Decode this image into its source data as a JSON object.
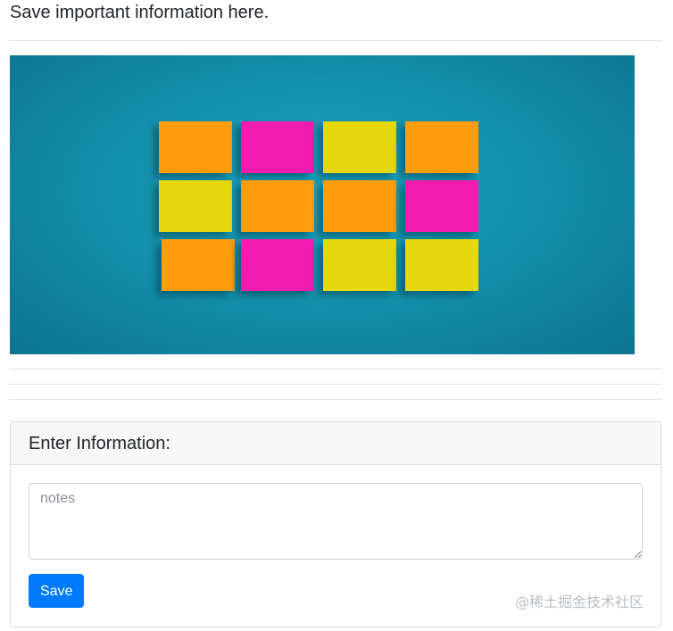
{
  "header": {
    "headline": "Save important information here."
  },
  "hero": {
    "description_icon": "sticky-notes-photo",
    "colors": {
      "background": "#1391ad",
      "orange": "#ff9d0a",
      "magenta": "#f01ab0",
      "yellow": "#e6d80a"
    },
    "notes_grid": [
      [
        "orange",
        "magenta",
        "yellow",
        "orange"
      ],
      [
        "yellow",
        "orange",
        "orange",
        "magenta"
      ],
      [
        "orange",
        "magenta",
        "yellow",
        "yellow"
      ]
    ]
  },
  "form": {
    "title": "Enter Information:",
    "notes_placeholder": "notes",
    "notes_value": "",
    "save_label": "Save"
  },
  "watermark": {
    "text": "@稀土掘金技术社区"
  },
  "colors": {
    "primary_button": "#007bff",
    "card_header_bg": "#f7f7f7"
  }
}
